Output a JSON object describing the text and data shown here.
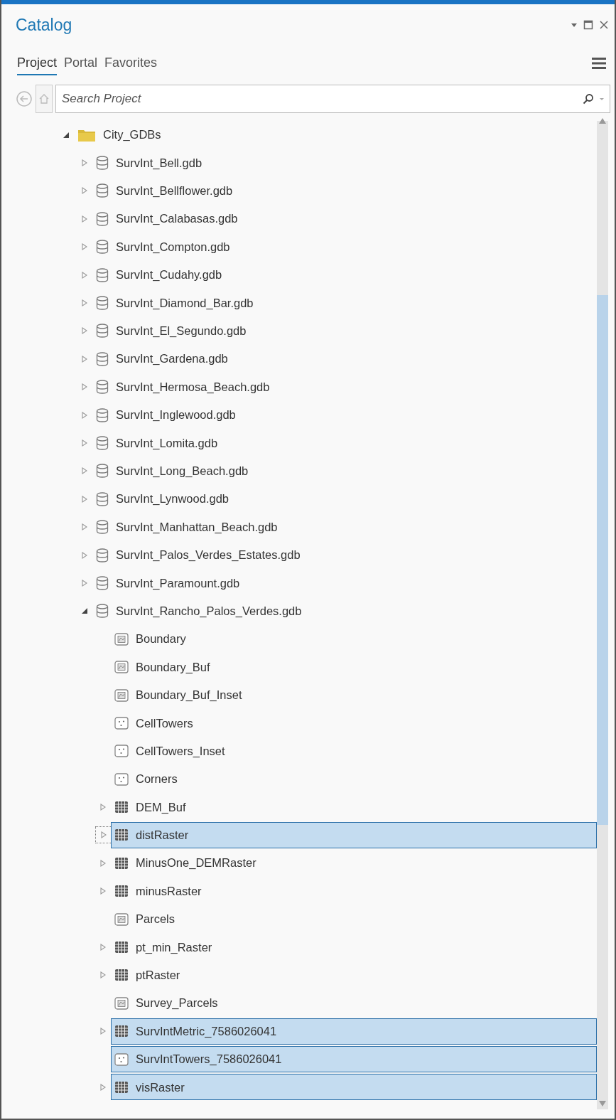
{
  "window": {
    "title": "Catalog"
  },
  "tabs": [
    {
      "label": "Project",
      "selected": true
    },
    {
      "label": "Portal",
      "selected": false
    },
    {
      "label": "Favorites",
      "selected": false
    }
  ],
  "search": {
    "placeholder": "Search Project"
  },
  "tree": [
    {
      "label": "City_GDBs",
      "kind": "folder",
      "expanded": true,
      "selected": false,
      "children": [
        {
          "label": "SurvInt_Bell.gdb",
          "kind": "gdb",
          "expanded": false,
          "selected": false
        },
        {
          "label": "SurvInt_Bellflower.gdb",
          "kind": "gdb",
          "expanded": false,
          "selected": false
        },
        {
          "label": "SurvInt_Calabasas.gdb",
          "kind": "gdb",
          "expanded": false,
          "selected": false
        },
        {
          "label": "SurvInt_Compton.gdb",
          "kind": "gdb",
          "expanded": false,
          "selected": false
        },
        {
          "label": "SurvInt_Cudahy.gdb",
          "kind": "gdb",
          "expanded": false,
          "selected": false
        },
        {
          "label": "SurvInt_Diamond_Bar.gdb",
          "kind": "gdb",
          "expanded": false,
          "selected": false
        },
        {
          "label": "SurvInt_El_Segundo.gdb",
          "kind": "gdb",
          "expanded": false,
          "selected": false
        },
        {
          "label": "SurvInt_Gardena.gdb",
          "kind": "gdb",
          "expanded": false,
          "selected": false
        },
        {
          "label": "SurvInt_Hermosa_Beach.gdb",
          "kind": "gdb",
          "expanded": false,
          "selected": false
        },
        {
          "label": "SurvInt_Inglewood.gdb",
          "kind": "gdb",
          "expanded": false,
          "selected": false
        },
        {
          "label": "SurvInt_Lomita.gdb",
          "kind": "gdb",
          "expanded": false,
          "selected": false
        },
        {
          "label": "SurvInt_Long_Beach.gdb",
          "kind": "gdb",
          "expanded": false,
          "selected": false
        },
        {
          "label": "SurvInt_Lynwood.gdb",
          "kind": "gdb",
          "expanded": false,
          "selected": false
        },
        {
          "label": "SurvInt_Manhattan_Beach.gdb",
          "kind": "gdb",
          "expanded": false,
          "selected": false
        },
        {
          "label": "SurvInt_Palos_Verdes_Estates.gdb",
          "kind": "gdb",
          "expanded": false,
          "selected": false
        },
        {
          "label": "SurvInt_Paramount.gdb",
          "kind": "gdb",
          "expanded": false,
          "selected": false
        },
        {
          "label": "SurvInt_Rancho_Palos_Verdes.gdb",
          "kind": "gdb",
          "expanded": true,
          "selected": false,
          "children": [
            {
              "label": "Boundary",
              "kind": "polygon",
              "selected": false
            },
            {
              "label": "Boundary_Buf",
              "kind": "polygon",
              "selected": false
            },
            {
              "label": "Boundary_Buf_Inset",
              "kind": "polygon",
              "selected": false
            },
            {
              "label": "CellTowers",
              "kind": "point",
              "selected": false
            },
            {
              "label": "CellTowers_Inset",
              "kind": "point",
              "selected": false
            },
            {
              "label": "Corners",
              "kind": "point",
              "selected": false
            },
            {
              "label": "DEM_Buf",
              "kind": "raster",
              "expanded": false,
              "selected": false
            },
            {
              "label": "distRaster",
              "kind": "raster",
              "expanded": false,
              "selected": true,
              "focused": true
            },
            {
              "label": "MinusOne_DEMRaster",
              "kind": "raster",
              "expanded": false,
              "selected": false
            },
            {
              "label": "minusRaster",
              "kind": "raster",
              "expanded": false,
              "selected": false
            },
            {
              "label": "Parcels",
              "kind": "polygon",
              "selected": false
            },
            {
              "label": "pt_min_Raster",
              "kind": "raster",
              "expanded": false,
              "selected": false
            },
            {
              "label": "ptRaster",
              "kind": "raster",
              "expanded": false,
              "selected": false
            },
            {
              "label": "Survey_Parcels",
              "kind": "polygon",
              "selected": false
            },
            {
              "label": "SurvIntMetric_7586026041",
              "kind": "raster",
              "expanded": false,
              "selected": true
            },
            {
              "label": "SurvIntTowers_7586026041",
              "kind": "point",
              "selected": true
            },
            {
              "label": "visRaster",
              "kind": "raster",
              "expanded": false,
              "selected": true
            }
          ]
        }
      ]
    }
  ]
}
